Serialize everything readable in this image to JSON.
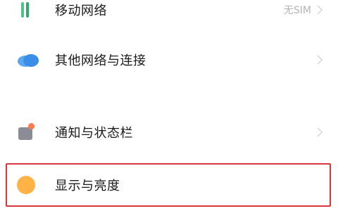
{
  "settings": {
    "items": [
      {
        "key": "mobile_network",
        "label": "移动网络",
        "value": "无SIM",
        "icon": "mobile-network-icon",
        "icon_color": "#2faa6b"
      },
      {
        "key": "other_networks",
        "label": "其他网络与连接",
        "value": "",
        "icon": "cloud-icon",
        "icon_color": "#3b8ee8"
      },
      {
        "key": "notifications",
        "label": "通知与状态栏",
        "value": "",
        "icon": "notification-icon",
        "icon_color": "#8c8c98"
      },
      {
        "key": "display",
        "label": "显示与亮度",
        "value": "",
        "icon": "display-brightness-icon",
        "icon_color": "#ffb347",
        "highlighted": true
      }
    ]
  },
  "colors": {
    "highlight_border": "#d9363e",
    "chevron": "#c8c8c8",
    "value_text": "#b3b3b3"
  }
}
